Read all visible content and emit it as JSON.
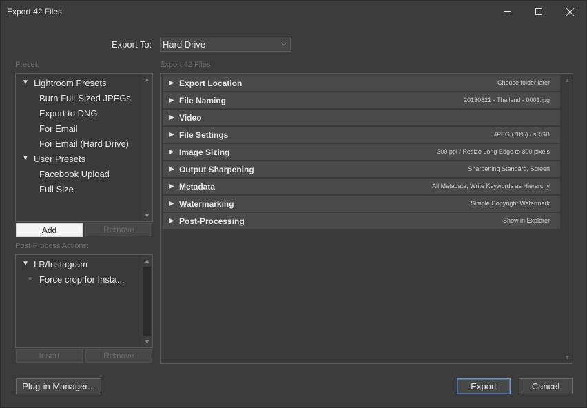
{
  "window": {
    "title": "Export 42 Files"
  },
  "export_to": {
    "label": "Export To:",
    "value": "Hard Drive"
  },
  "preset": {
    "label": "Preset:",
    "groups": [
      {
        "name": "Lightroom Presets",
        "items": [
          "Burn Full-Sized JPEGs",
          "Export to DNG",
          "For Email",
          "For Email (Hard Drive)"
        ]
      },
      {
        "name": "User Presets",
        "items": [
          "Facebook Upload",
          "Full Size"
        ]
      }
    ],
    "add_label": "Add",
    "remove_label": "Remove"
  },
  "post_process": {
    "label": "Post-Process Actions:",
    "group": "LR/Instagram",
    "items": [
      "Force crop for Insta..."
    ],
    "insert_label": "Insert",
    "remove_label": "Remove"
  },
  "main": {
    "label": "Export 42 Files",
    "sections": [
      {
        "title": "Export Location",
        "summary": "Choose folder later"
      },
      {
        "title": "File Naming",
        "summary": "20130821 - Thailand - 0001.jpg"
      },
      {
        "title": "Video",
        "summary": ""
      },
      {
        "title": "File Settings",
        "summary": "JPEG (70%) / sRGB"
      },
      {
        "title": "Image Sizing",
        "summary": "300 ppi / Resize Long Edge to 800 pixels"
      },
      {
        "title": "Output Sharpening",
        "summary": "Sharpening Standard, Screen"
      },
      {
        "title": "Metadata",
        "summary": "All Metadata, Write Keywords as Hierarchy"
      },
      {
        "title": "Watermarking",
        "summary": "Simple Copyright Watermark"
      },
      {
        "title": "Post-Processing",
        "summary": "Show in Explorer"
      }
    ]
  },
  "footer": {
    "plugin_manager_label": "Plug-in Manager...",
    "export_label": "Export",
    "cancel_label": "Cancel"
  },
  "icons": {
    "expand": "triangle-right-icon",
    "collapse": "triangle-down-icon",
    "dropdown": "chevron-down-icon",
    "minimize": "minimize-icon",
    "maximize": "maximize-icon",
    "close": "close-icon"
  },
  "colors": {
    "background": "#3c3c3c",
    "row": "#4a4a4a",
    "default_button_border": "#6c9ad6"
  }
}
